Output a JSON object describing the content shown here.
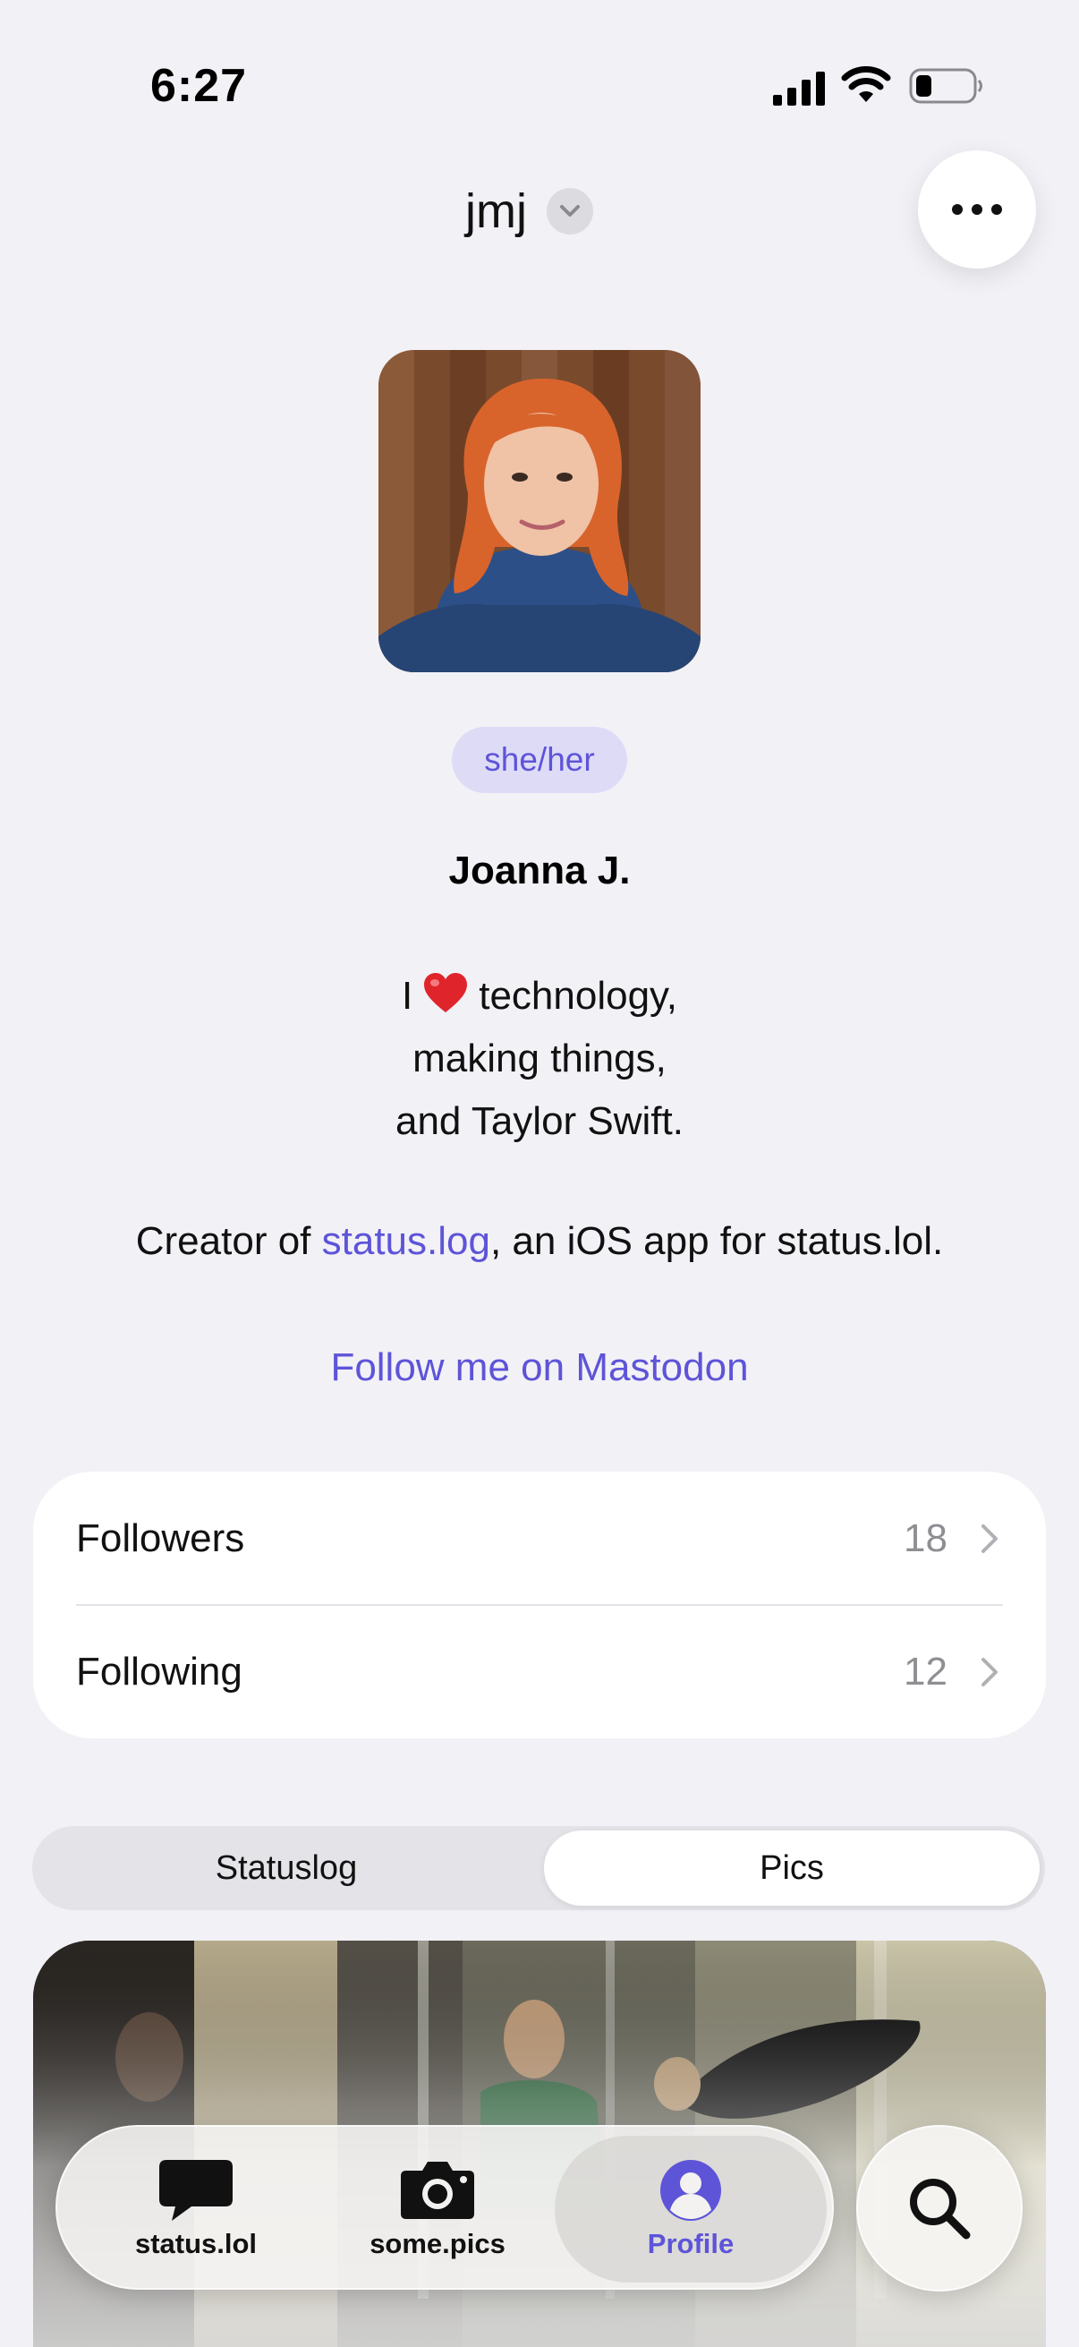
{
  "status_bar": {
    "time": "6:27"
  },
  "header": {
    "account_name": "jmj"
  },
  "profile": {
    "pronouns": "she/her",
    "display_name": "Joanna J.",
    "bio_line1_before": "I",
    "bio_line1_after": "technology,",
    "bio_line2": "making things,",
    "bio_line3": "and Taylor Swift.",
    "creator_prefix": "Creator of ",
    "creator_link": "status.log",
    "creator_suffix": ", an iOS app for status.lol.",
    "mastodon_link": "Follow me on Mastodon"
  },
  "follow": {
    "followers_label": "Followers",
    "followers_count": "18",
    "following_label": "Following",
    "following_count": "12"
  },
  "segmented": {
    "statuslog": "Statuslog",
    "pics": "Pics",
    "selected": "Pics"
  },
  "tab_bar": {
    "items": [
      {
        "label": "status.lol",
        "icon": "speech-bubble-icon"
      },
      {
        "label": "some.pics",
        "icon": "camera-icon"
      },
      {
        "label": "Profile",
        "icon": "person-circle-icon"
      }
    ],
    "selected": "Profile",
    "accent": "#5e54d8"
  },
  "colors": {
    "accent": "#5e54d8",
    "pill_bg": "#dedbf7",
    "background": "#f2f1f6"
  }
}
